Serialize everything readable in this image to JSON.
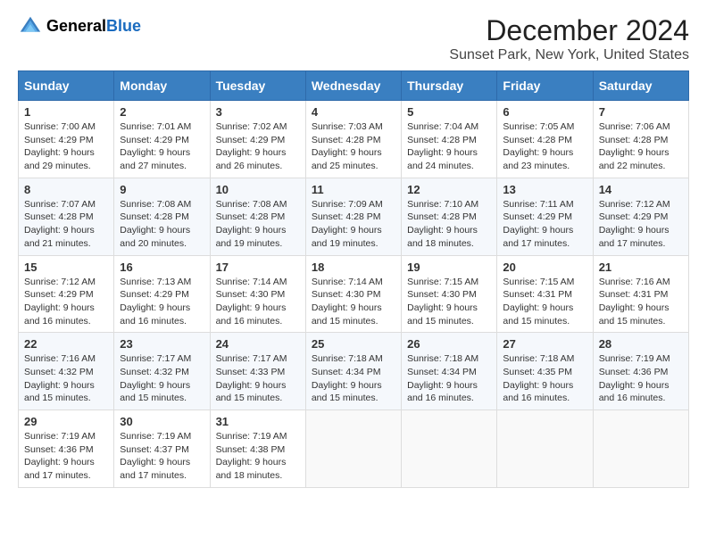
{
  "logo": {
    "text_general": "General",
    "text_blue": "Blue"
  },
  "header": {
    "title": "December 2024",
    "subtitle": "Sunset Park, New York, United States"
  },
  "weekdays": [
    "Sunday",
    "Monday",
    "Tuesday",
    "Wednesday",
    "Thursday",
    "Friday",
    "Saturday"
  ],
  "weeks": [
    [
      {
        "day": "1",
        "sunrise": "7:00 AM",
        "sunset": "4:29 PM",
        "daylight": "9 hours and 29 minutes."
      },
      {
        "day": "2",
        "sunrise": "7:01 AM",
        "sunset": "4:29 PM",
        "daylight": "9 hours and 27 minutes."
      },
      {
        "day": "3",
        "sunrise": "7:02 AM",
        "sunset": "4:29 PM",
        "daylight": "9 hours and 26 minutes."
      },
      {
        "day": "4",
        "sunrise": "7:03 AM",
        "sunset": "4:28 PM",
        "daylight": "9 hours and 25 minutes."
      },
      {
        "day": "5",
        "sunrise": "7:04 AM",
        "sunset": "4:28 PM",
        "daylight": "9 hours and 24 minutes."
      },
      {
        "day": "6",
        "sunrise": "7:05 AM",
        "sunset": "4:28 PM",
        "daylight": "9 hours and 23 minutes."
      },
      {
        "day": "7",
        "sunrise": "7:06 AM",
        "sunset": "4:28 PM",
        "daylight": "9 hours and 22 minutes."
      }
    ],
    [
      {
        "day": "8",
        "sunrise": "7:07 AM",
        "sunset": "4:28 PM",
        "daylight": "9 hours and 21 minutes."
      },
      {
        "day": "9",
        "sunrise": "7:08 AM",
        "sunset": "4:28 PM",
        "daylight": "9 hours and 20 minutes."
      },
      {
        "day": "10",
        "sunrise": "7:08 AM",
        "sunset": "4:28 PM",
        "daylight": "9 hours and 19 minutes."
      },
      {
        "day": "11",
        "sunrise": "7:09 AM",
        "sunset": "4:28 PM",
        "daylight": "9 hours and 19 minutes."
      },
      {
        "day": "12",
        "sunrise": "7:10 AM",
        "sunset": "4:28 PM",
        "daylight": "9 hours and 18 minutes."
      },
      {
        "day": "13",
        "sunrise": "7:11 AM",
        "sunset": "4:29 PM",
        "daylight": "9 hours and 17 minutes."
      },
      {
        "day": "14",
        "sunrise": "7:12 AM",
        "sunset": "4:29 PM",
        "daylight": "9 hours and 17 minutes."
      }
    ],
    [
      {
        "day": "15",
        "sunrise": "7:12 AM",
        "sunset": "4:29 PM",
        "daylight": "9 hours and 16 minutes."
      },
      {
        "day": "16",
        "sunrise": "7:13 AM",
        "sunset": "4:29 PM",
        "daylight": "9 hours and 16 minutes."
      },
      {
        "day": "17",
        "sunrise": "7:14 AM",
        "sunset": "4:30 PM",
        "daylight": "9 hours and 16 minutes."
      },
      {
        "day": "18",
        "sunrise": "7:14 AM",
        "sunset": "4:30 PM",
        "daylight": "9 hours and 15 minutes."
      },
      {
        "day": "19",
        "sunrise": "7:15 AM",
        "sunset": "4:30 PM",
        "daylight": "9 hours and 15 minutes."
      },
      {
        "day": "20",
        "sunrise": "7:15 AM",
        "sunset": "4:31 PM",
        "daylight": "9 hours and 15 minutes."
      },
      {
        "day": "21",
        "sunrise": "7:16 AM",
        "sunset": "4:31 PM",
        "daylight": "9 hours and 15 minutes."
      }
    ],
    [
      {
        "day": "22",
        "sunrise": "7:16 AM",
        "sunset": "4:32 PM",
        "daylight": "9 hours and 15 minutes."
      },
      {
        "day": "23",
        "sunrise": "7:17 AM",
        "sunset": "4:32 PM",
        "daylight": "9 hours and 15 minutes."
      },
      {
        "day": "24",
        "sunrise": "7:17 AM",
        "sunset": "4:33 PM",
        "daylight": "9 hours and 15 minutes."
      },
      {
        "day": "25",
        "sunrise": "7:18 AM",
        "sunset": "4:34 PM",
        "daylight": "9 hours and 15 minutes."
      },
      {
        "day": "26",
        "sunrise": "7:18 AM",
        "sunset": "4:34 PM",
        "daylight": "9 hours and 16 minutes."
      },
      {
        "day": "27",
        "sunrise": "7:18 AM",
        "sunset": "4:35 PM",
        "daylight": "9 hours and 16 minutes."
      },
      {
        "day": "28",
        "sunrise": "7:19 AM",
        "sunset": "4:36 PM",
        "daylight": "9 hours and 16 minutes."
      }
    ],
    [
      {
        "day": "29",
        "sunrise": "7:19 AM",
        "sunset": "4:36 PM",
        "daylight": "9 hours and 17 minutes."
      },
      {
        "day": "30",
        "sunrise": "7:19 AM",
        "sunset": "4:37 PM",
        "daylight": "9 hours and 17 minutes."
      },
      {
        "day": "31",
        "sunrise": "7:19 AM",
        "sunset": "4:38 PM",
        "daylight": "9 hours and 18 minutes."
      },
      null,
      null,
      null,
      null
    ]
  ],
  "labels": {
    "sunrise": "Sunrise:",
    "sunset": "Sunset:",
    "daylight": "Daylight:"
  }
}
